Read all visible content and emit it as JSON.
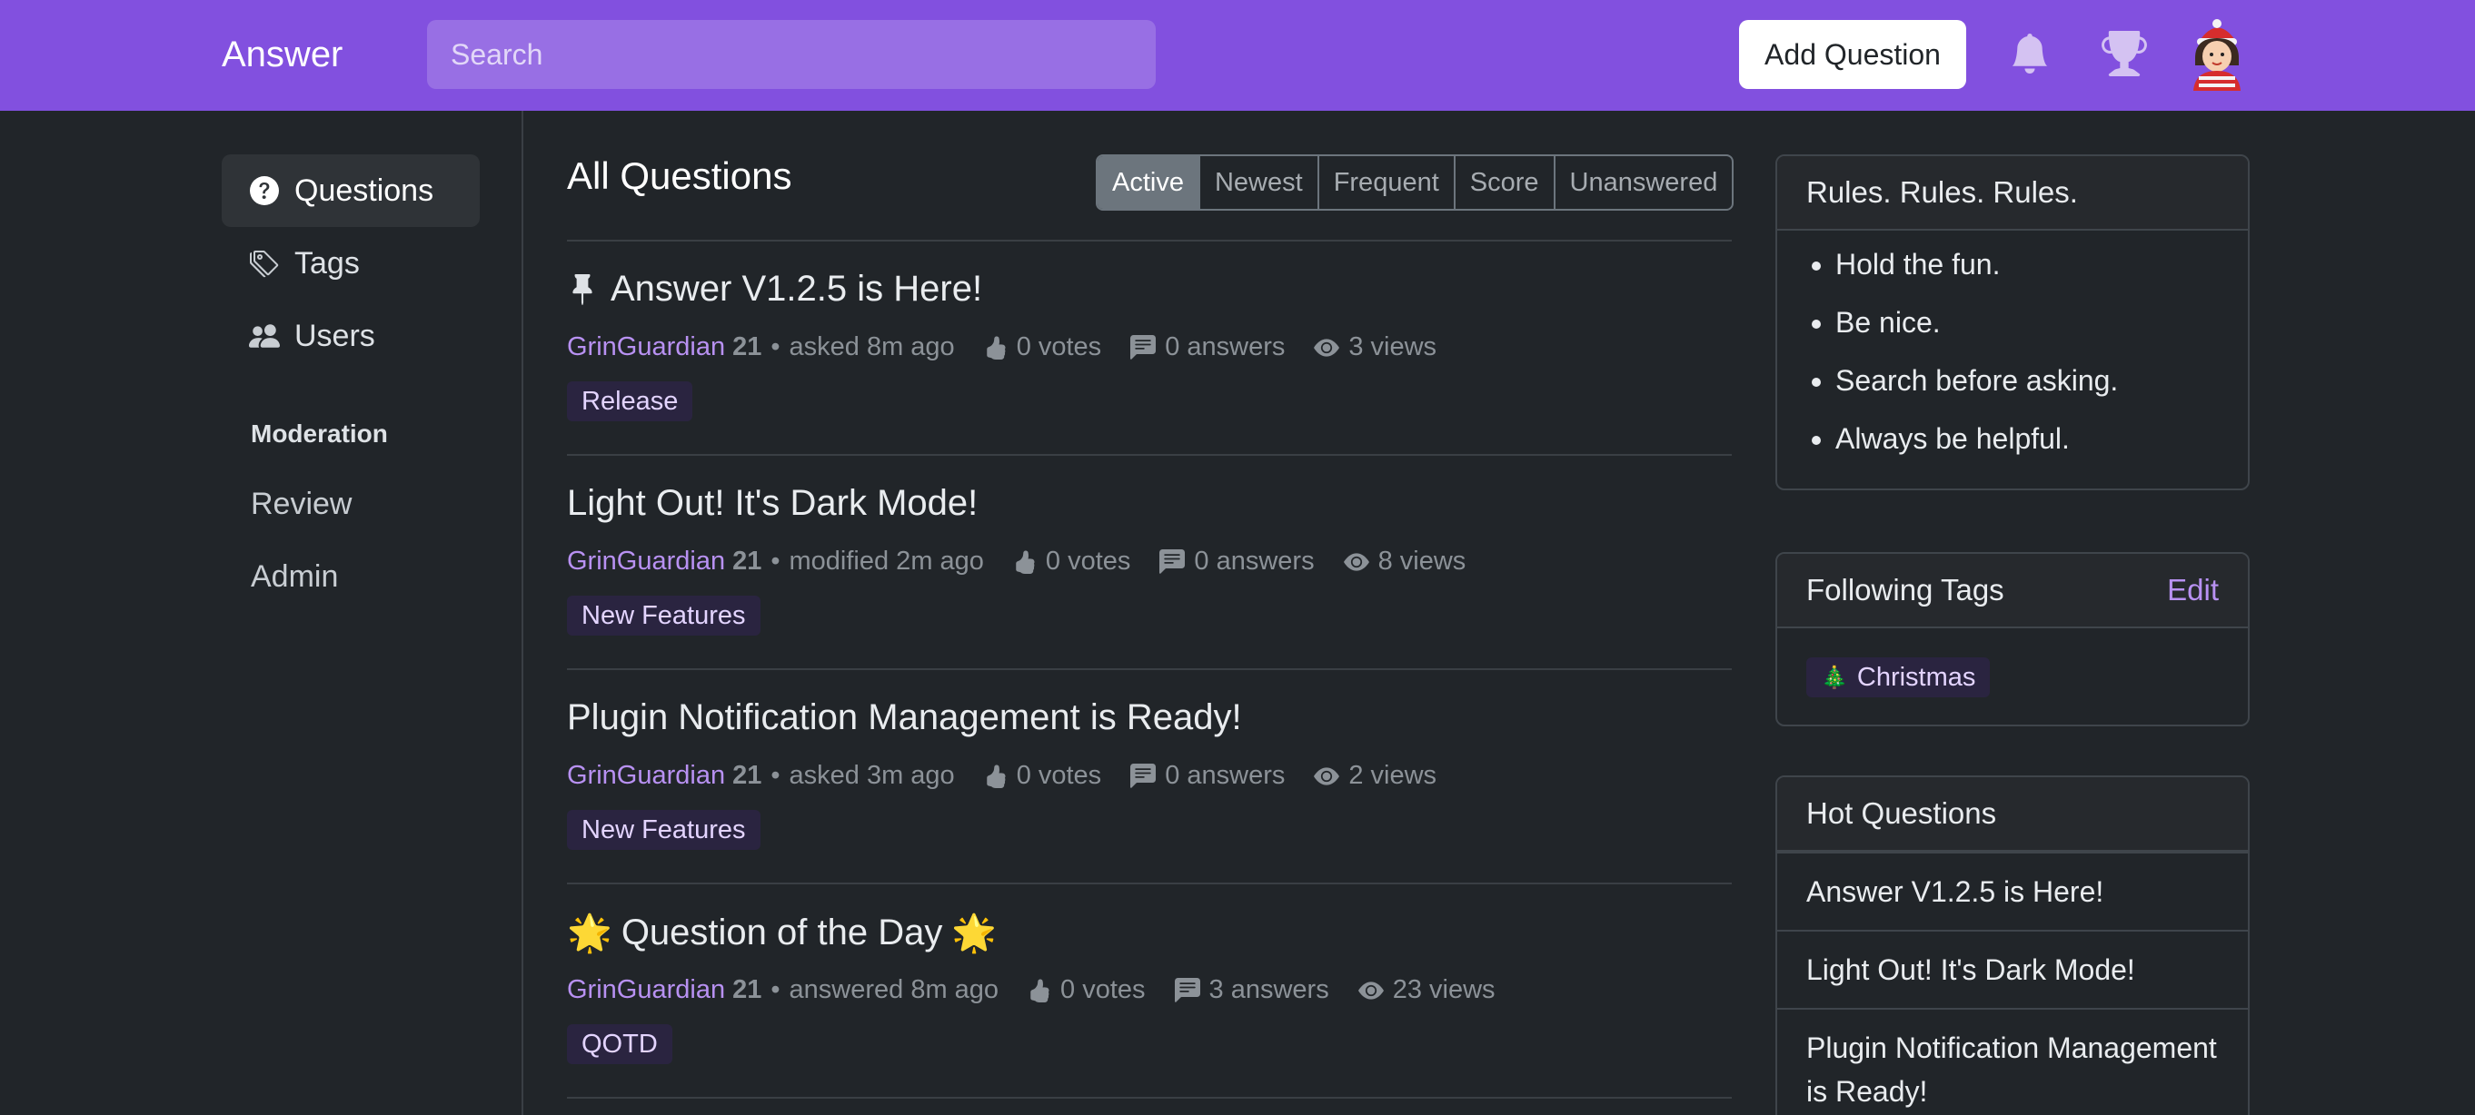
{
  "header": {
    "brand": "Answer",
    "search_placeholder": "Search",
    "add_question": "Add Question"
  },
  "sidebar": {
    "items": [
      {
        "label": "Questions",
        "icon": "question-circle-icon"
      },
      {
        "label": "Tags",
        "icon": "tags-icon"
      },
      {
        "label": "Users",
        "icon": "people-icon"
      }
    ],
    "moderation_heading": "Moderation",
    "moderation_links": [
      "Review",
      "Admin"
    ]
  },
  "main": {
    "title": "All Questions",
    "tabs": [
      "Active",
      "Newest",
      "Frequent",
      "Score",
      "Unanswered"
    ],
    "active_tab": "Active",
    "questions": [
      {
        "title": "Answer V1.2.5 is Here!",
        "prefix_icon": "pin-icon",
        "user": "GrinGuardian",
        "rep": "21",
        "action": "asked 8m ago",
        "votes": "0 votes",
        "answers": "0 answers",
        "views": "3 views",
        "tag": "Release"
      },
      {
        "title": "Light Out! It's Dark Mode!",
        "user": "GrinGuardian",
        "rep": "21",
        "action": "modified 2m ago",
        "votes": "0 votes",
        "answers": "0 answers",
        "views": "8 views",
        "tag": "New Features"
      },
      {
        "title": "Plugin Notification Management is Ready!",
        "user": "GrinGuardian",
        "rep": "21",
        "action": "asked 3m ago",
        "votes": "0 votes",
        "answers": "0 answers",
        "views": "2 views",
        "tag": "New Features"
      },
      {
        "title": "Question of the Day",
        "emoji": "🌟",
        "user": "GrinGuardian",
        "rep": "21",
        "action": "answered 8m ago",
        "votes": "0 votes",
        "answers": "3 answers",
        "views": "23 views",
        "tag": "QOTD"
      }
    ]
  },
  "rules_card": {
    "title": "Rules. Rules. Rules.",
    "items": [
      "Hold the fun.",
      "Be nice.",
      "Search before asking.",
      "Always be helpful."
    ]
  },
  "following_tags": {
    "title": "Following Tags",
    "edit_label": "Edit",
    "tag": "Christmas",
    "tag_emoji": "🎄"
  },
  "hot_questions": {
    "title": "Hot Questions",
    "items": [
      "Answer V1.2.5 is Here!",
      "Light Out! It's Dark Mode!",
      "Plugin Notification Management is Ready!"
    ]
  },
  "colors": {
    "header_bg": "#8250df",
    "page_bg": "#212529",
    "link_purple": "#b891f2",
    "tag_bg": "#2a2440"
  }
}
